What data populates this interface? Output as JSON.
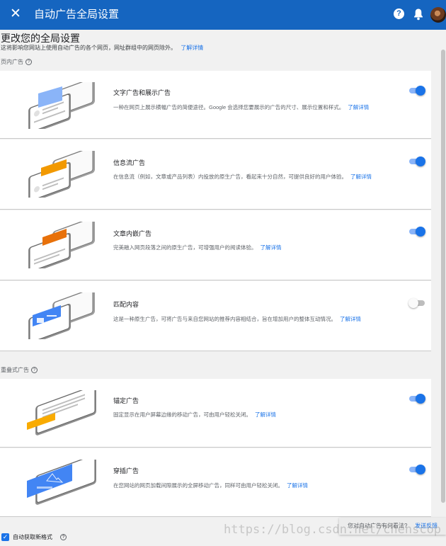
{
  "header": {
    "close_icon": "close-icon",
    "title": "自动广告全局设置",
    "help_label": "?",
    "help_icon": "help-circle-icon",
    "bell_icon": "notification-bell-icon",
    "avatar_icon": "user-avatar"
  },
  "page": {
    "title": "更改您的全局设置",
    "description": "这将影响您网站上使用自动广告的各个网页，网址群组中的网页除外。",
    "learn_more": "了解详情"
  },
  "sections": {
    "in_page": "页内广告",
    "overlay": "重叠式广告",
    "help_icon": "question-circle-icon",
    "help_label": "?"
  },
  "cards": [
    {
      "name": "文字广告和展示广告",
      "description": "一种在网页上展示横幅广告的简便途径。Google 会选择您要展示的广告的尺寸、展示位置和样式。",
      "link": "了解详情",
      "enabled": true,
      "accent": "#8ab4f8"
    },
    {
      "name": "信息流广告",
      "description": "在信息流（例如，文章或产品列表）内投放的原生广告，看起来十分自然，可提供良好的用户体验。",
      "link": "了解详情",
      "enabled": true,
      "accent": "#f29900"
    },
    {
      "name": "文章内嵌广告",
      "description": "完美融入网页段落之间的原生广告，可增强用户的阅读体验。",
      "link": "了解详情",
      "enabled": true,
      "accent": "#e8710a"
    },
    {
      "name": "匹配内容",
      "description": "这是一种原生广告，可将广告与来自您网站的推荐内容相结合，旨在增加用户的整体互动情况。",
      "link": "了解详情",
      "enabled": false,
      "accent": "#4285f4"
    },
    {
      "name": "锚定广告",
      "description": "固定显示在用户屏幕边缘的移动广告，可由用户轻松关闭。",
      "link": "了解详情",
      "enabled": true,
      "accent": "#f9ab00"
    },
    {
      "name": "穿插广告",
      "description": "在您网站的网页加载间隙展示的全屏移动广告，同样可由用户轻松关闭。",
      "link": "了解详情",
      "enabled": true,
      "accent": "#4285f4"
    }
  ],
  "footer": {
    "checkbox_label": "自动获取新格式",
    "checked": true,
    "check_mark": "✓",
    "help_label": "?"
  },
  "feedback": {
    "question": "您对自动广告有何看法?",
    "action": "发送反馈"
  },
  "watermark": "https://blog.csdn.net/chenscop"
}
